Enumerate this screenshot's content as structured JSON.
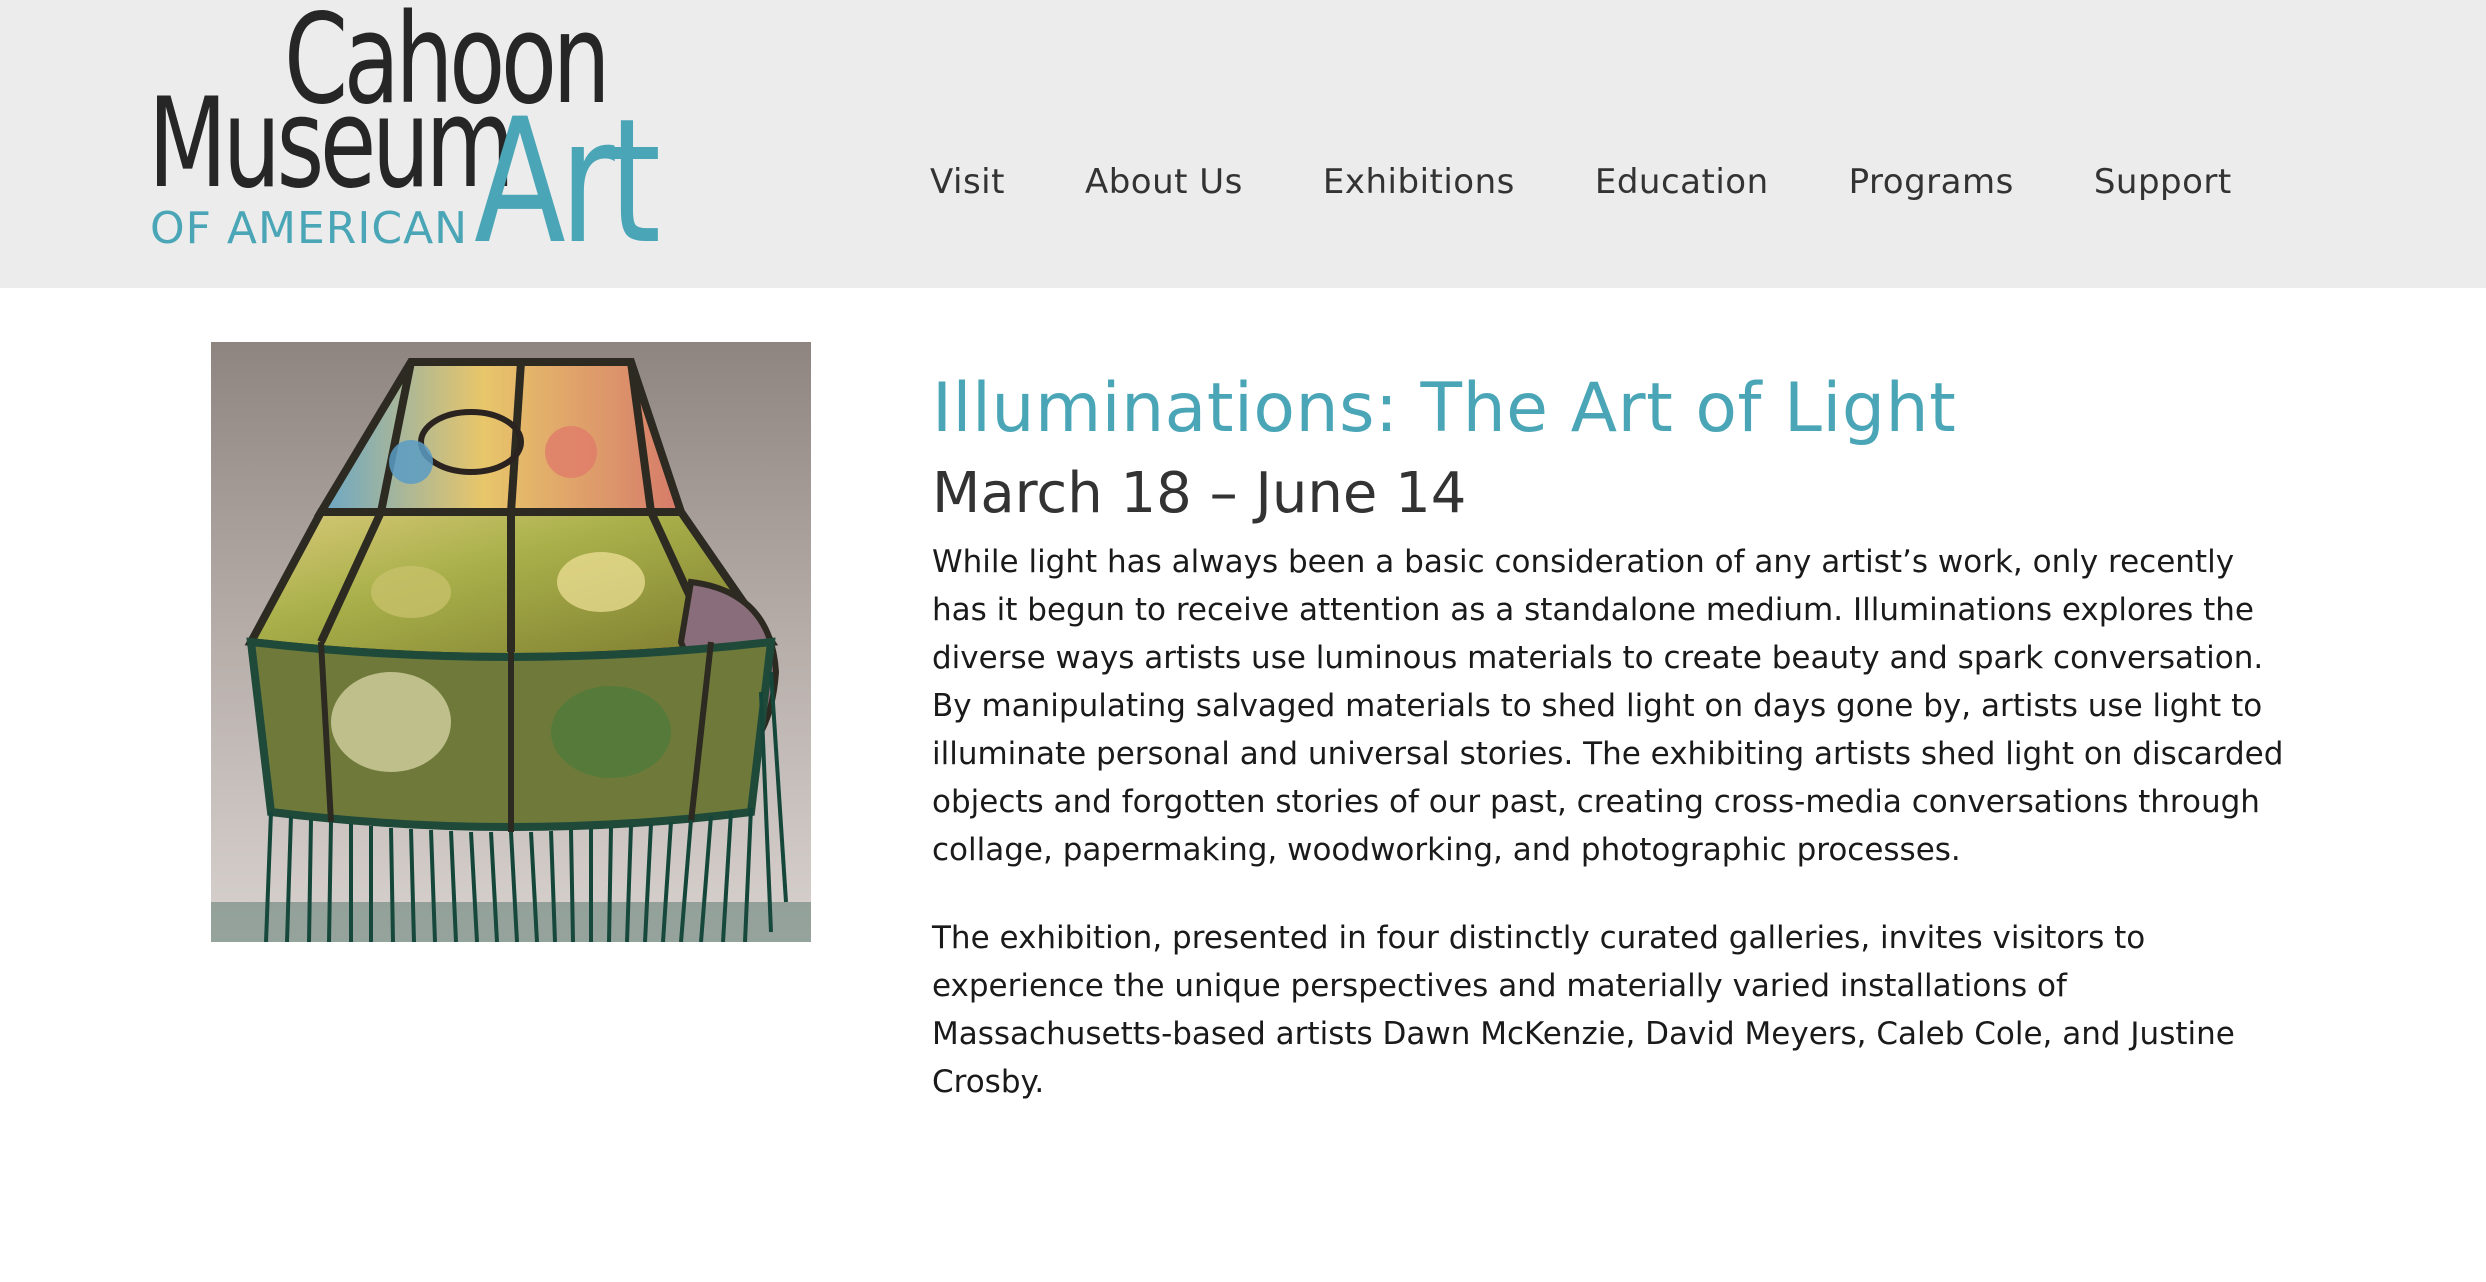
{
  "header": {
    "logo": {
      "line1": "Cahoon",
      "line2": "Museum",
      "line3_prefix": "OF AMERICAN",
      "line3_big": "Art",
      "brand_color": "#4aa6b6",
      "text_color": "#262626"
    },
    "nav": {
      "items": [
        {
          "label": "Visit"
        },
        {
          "label": "About Us"
        },
        {
          "label": "Exhibitions"
        },
        {
          "label": "Education"
        },
        {
          "label": "Programs"
        },
        {
          "label": "Support"
        }
      ]
    },
    "background_color": "#ececec"
  },
  "exhibition": {
    "image_icon": "lampshade-artwork-image",
    "title": "Illuminations: The Art of Light",
    "dates": "March 18 – June 14",
    "paragraphs": [
      "While light has always been a basic consideration of any artist’s work, only recently has it begun to receive attention as a standalone medium. Illuminations explores the diverse ways artists use luminous materials to create beauty and spark conversation. By manipulating salvaged materials to shed light on days gone by, artists use light to illuminate personal and universal stories. The exhibiting artists shed light on discarded objects and forgotten stories of our past, creating cross-media conversations through collage, papermaking, woodworking, and photographic processes.",
      "The exhibition, presented in four distinctly curated galleries, invites visitors to experience the unique perspectives and materially varied installations of Massachusetts-based artists Dawn McKenzie, David Meyers, Caleb Cole, and Justine Crosby."
    ],
    "title_color": "#4aa6b6",
    "dates_color": "#333333"
  }
}
